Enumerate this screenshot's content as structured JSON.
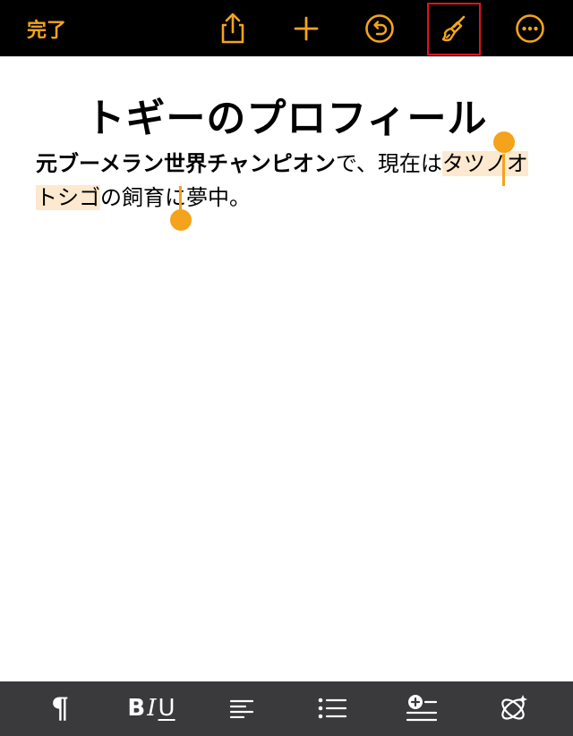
{
  "toolbar": {
    "done_label": "完了",
    "icons": [
      "share-icon",
      "add-icon",
      "undo-icon",
      "brush-icon",
      "more-icon"
    ],
    "accent_color": "#f3a51b",
    "highlight_color": "#e0141b"
  },
  "document": {
    "title": "トギーのプロフィール",
    "paragraph": {
      "bold_text": "元ブーメラン世界チャンピオン",
      "text_before_selection": "で、現在は",
      "selected_text": "タツノオトシゴ",
      "text_after_selection": "の飼育に夢中。"
    },
    "selection_color": "#fde9cf",
    "handle_color": "#f5a21c"
  },
  "format_bar": {
    "paragraph_label": "¶",
    "bold_label": "B",
    "italic_label": "I",
    "underline_label": "U",
    "icons": [
      "paragraph-icon",
      "text-style-icon",
      "align-left-icon",
      "list-icon",
      "insert-icon",
      "smart-annotation-icon"
    ]
  }
}
